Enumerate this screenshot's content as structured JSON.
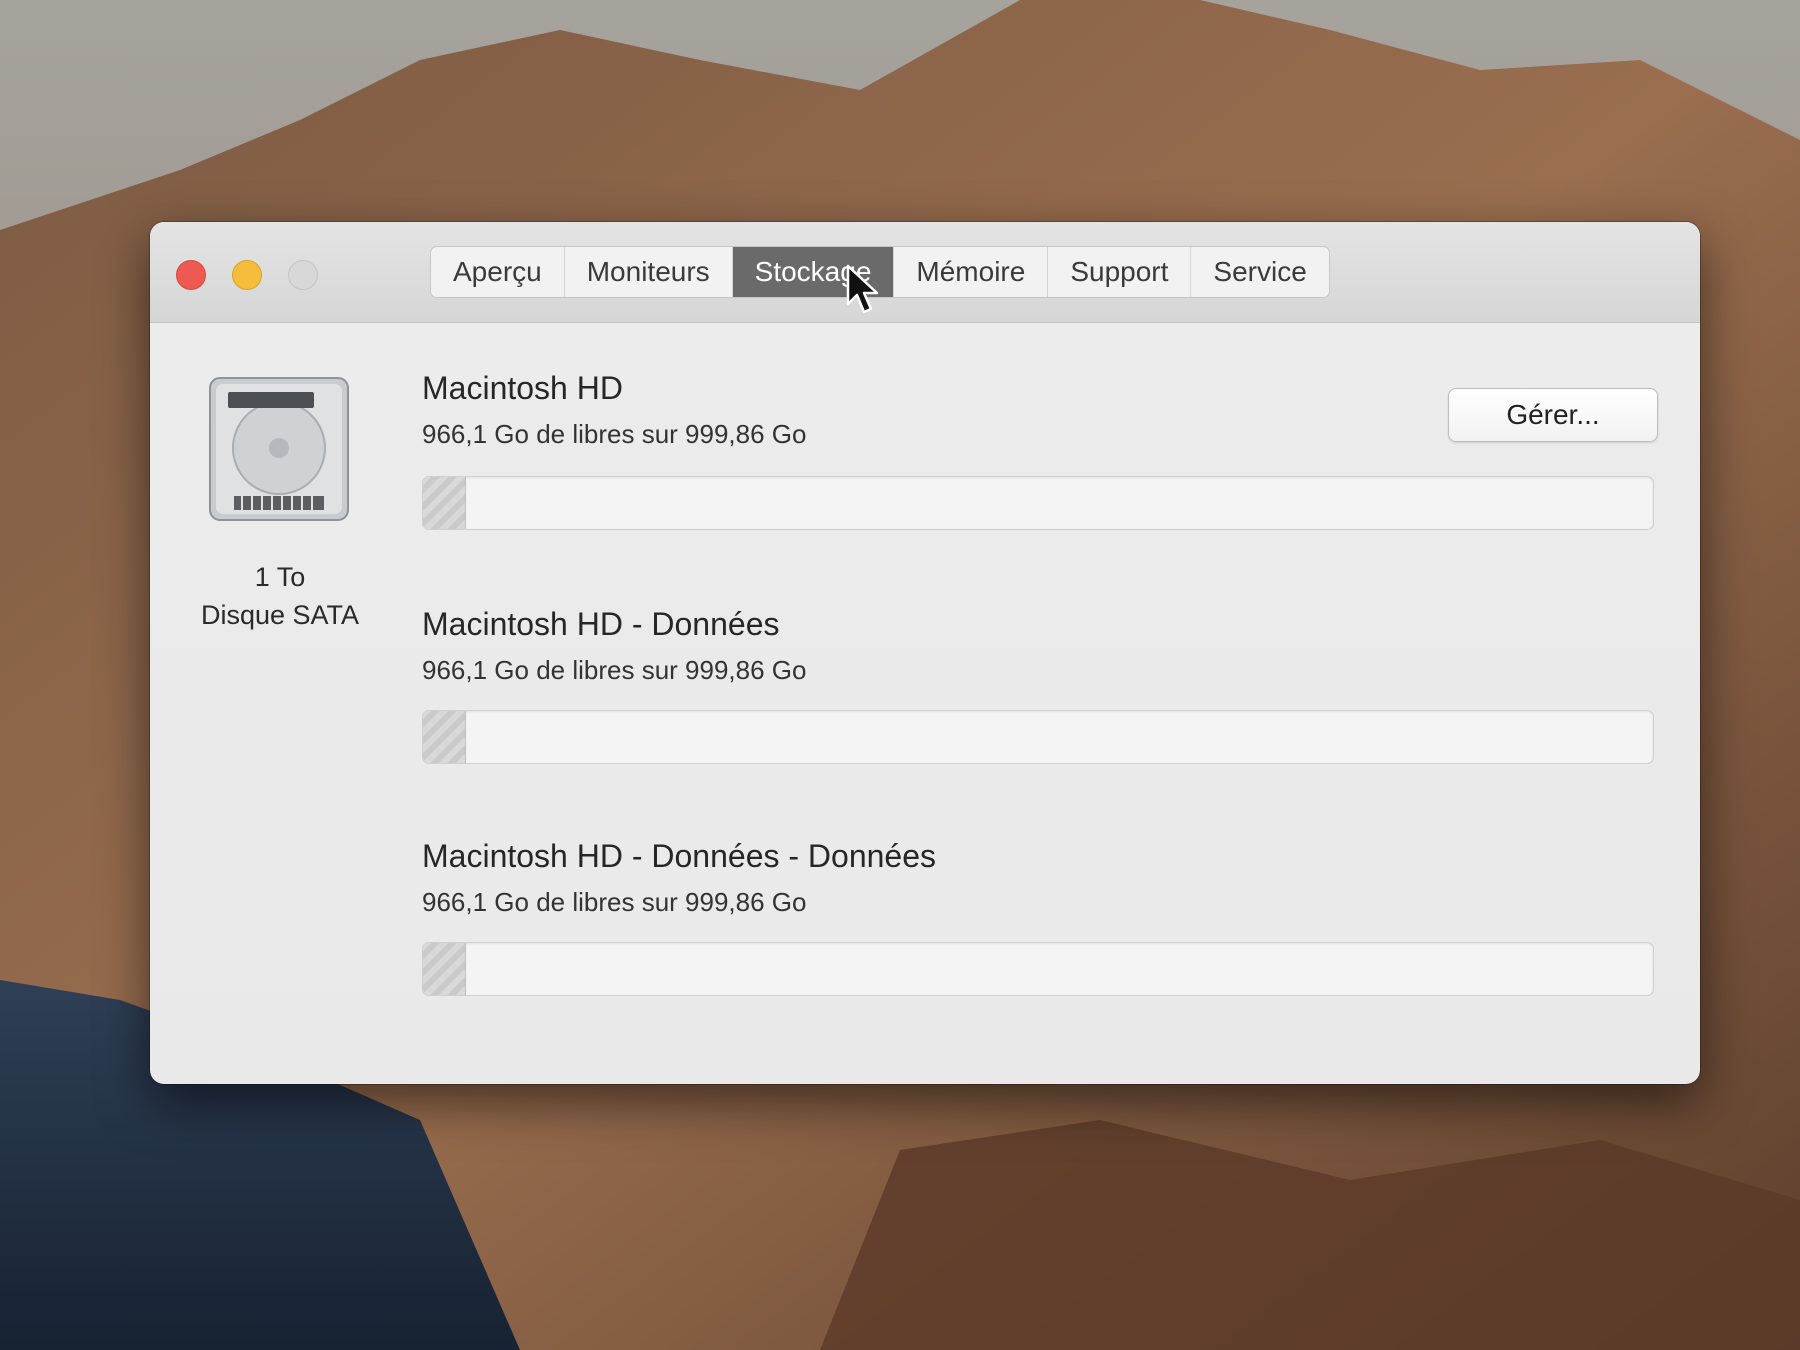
{
  "tabs": [
    {
      "label": "Aperçu",
      "active": false
    },
    {
      "label": "Moniteurs",
      "active": false
    },
    {
      "label": "Stockage",
      "active": true
    },
    {
      "label": "Mémoire",
      "active": false
    },
    {
      "label": "Support",
      "active": false
    },
    {
      "label": "Service",
      "active": false
    }
  ],
  "disk": {
    "icon": "hard-drive-icon",
    "size": "1 To",
    "type": "Disque SATA"
  },
  "manage_button": "Gérer...",
  "volumes": [
    {
      "name": "Macintosh HD",
      "free": "966,1 Go de libres sur 999,86 Go",
      "used_fraction": 0.034
    },
    {
      "name": "Macintosh HD - Données",
      "free": "966,1 Go de libres sur 999,86 Go",
      "used_fraction": 0.034
    },
    {
      "name": "Macintosh HD - Données - Données",
      "free": "966,1 Go de libres sur 999,86 Go",
      "used_fraction": 0.034
    }
  ],
  "colors": {
    "close": "#ee5a52",
    "minimize": "#f6bd3b",
    "zoom_inactive": "#d8d8d8",
    "active_tab": "#6a6a6a"
  },
  "cursor_icon": "arrow-cursor-icon"
}
